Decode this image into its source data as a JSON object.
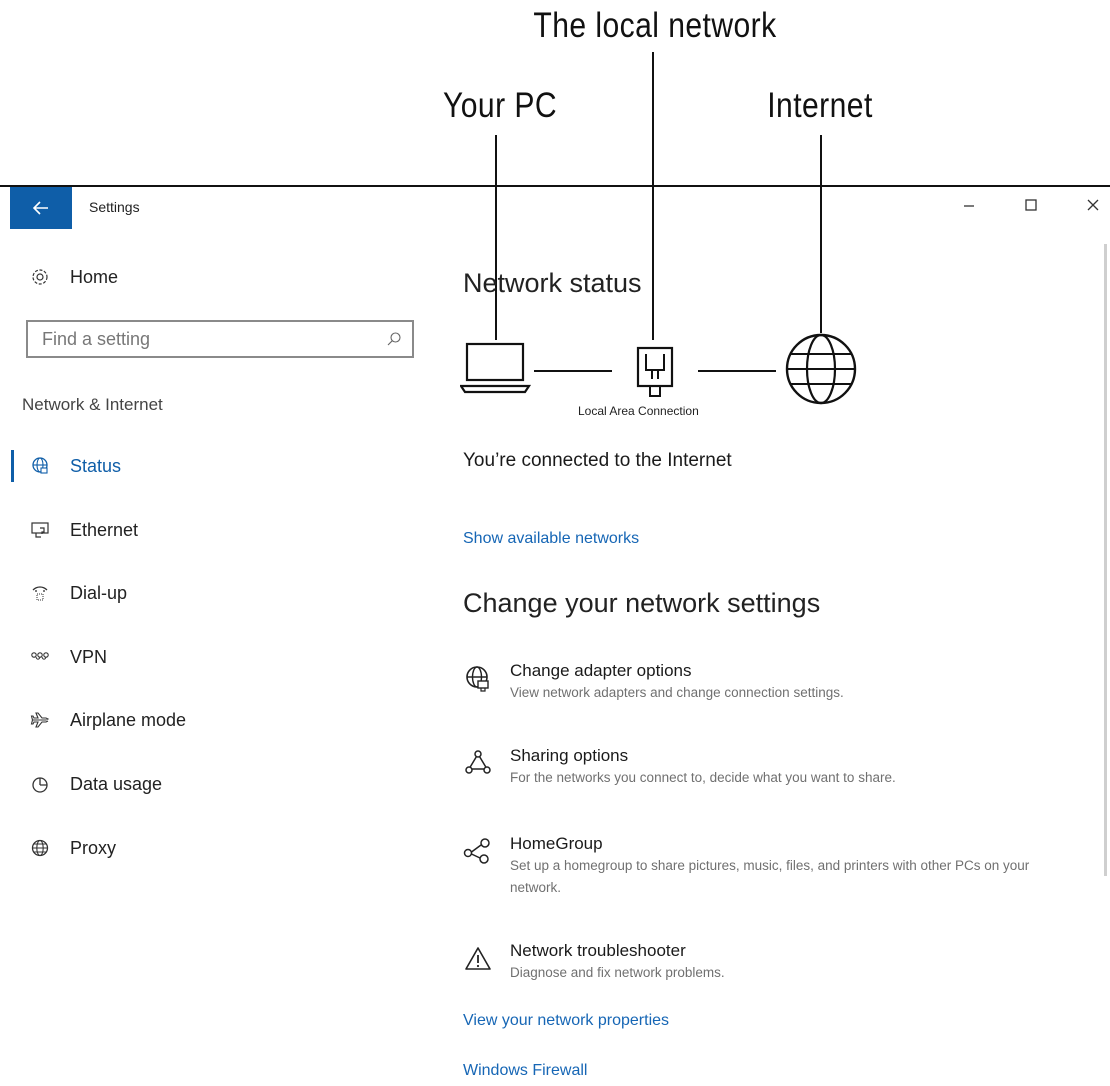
{
  "callouts": {
    "local_network": "The local network",
    "your_pc": "Your PC",
    "internet": "Internet"
  },
  "window": {
    "title": "Settings",
    "back_icon": "arrow-left-icon",
    "controls": [
      "minimize",
      "maximize",
      "close"
    ],
    "accent": "#0f5ea8"
  },
  "sidebar": {
    "home_label": "Home",
    "search_placeholder": "Find a setting",
    "section_label": "Network & Internet",
    "items": [
      {
        "label": "Status",
        "icon": "globe-status-icon",
        "active": true
      },
      {
        "label": "Ethernet",
        "icon": "ethernet-icon"
      },
      {
        "label": "Dial-up",
        "icon": "dialup-icon"
      },
      {
        "label": "VPN",
        "icon": "vpn-icon"
      },
      {
        "label": "Airplane mode",
        "icon": "airplane-icon"
      },
      {
        "label": "Data usage",
        "icon": "pie-chart-icon"
      },
      {
        "label": "Proxy",
        "icon": "globe-icon"
      }
    ]
  },
  "main": {
    "heading": "Network status",
    "connection_label": "Local Area Connection",
    "status_text": "You’re connected to the Internet",
    "show_networks_link": "Show available networks",
    "change_heading": "Change your network settings",
    "options": [
      {
        "title": "Change adapter options",
        "desc": "View network adapters and change connection settings.",
        "icon": "adapter-icon"
      },
      {
        "title": "Sharing options",
        "desc": "For the networks you connect to, decide what you want to share.",
        "icon": "sharing-icon"
      },
      {
        "title": "HomeGroup",
        "desc": "Set up a homegroup to share pictures, music, files, and printers with other PCs on your network.",
        "icon": "homegroup-icon"
      },
      {
        "title": "Network troubleshooter",
        "desc": "Diagnose and fix network problems.",
        "icon": "warning-icon"
      }
    ],
    "properties_link": "View your network properties",
    "firewall_link": "Windows Firewall"
  }
}
